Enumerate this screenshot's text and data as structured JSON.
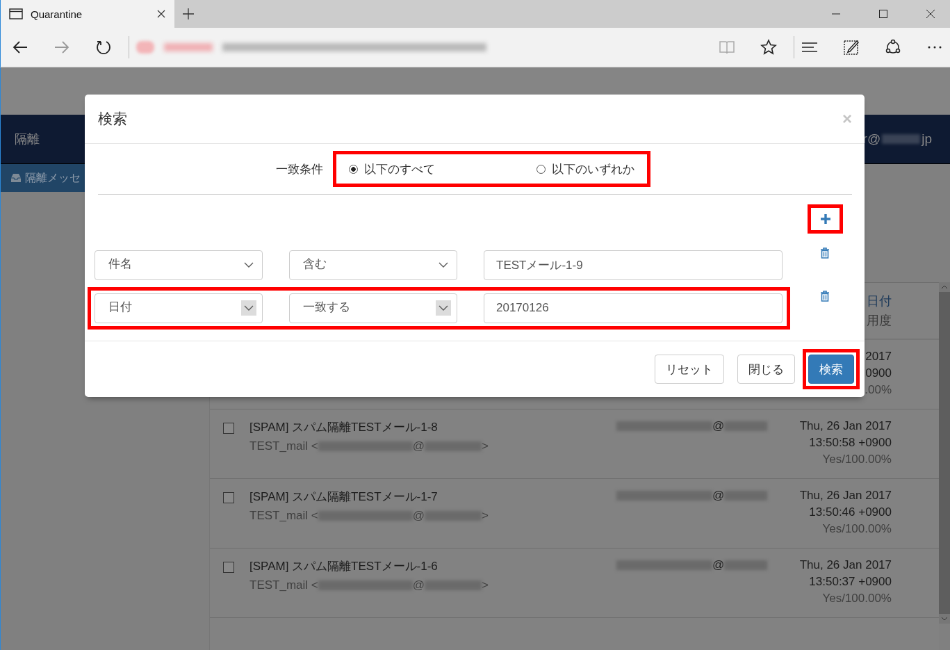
{
  "browser": {
    "tab_title": "Quarantine",
    "forward_disabled": true
  },
  "page": {
    "nav_title": "隔離",
    "user_prefix": "r@",
    "user_suffix": "jp",
    "sidebar_item": "隔離メッセ",
    "table_header": {
      "date": "日付",
      "score": "用度"
    },
    "partial_row": {
      "date": "2017",
      "time": "0900",
      "score": ".00%"
    },
    "rows": [
      {
        "checked": false,
        "subject": "[SPAM] スパム隔離TESTメール-1-8",
        "sender_prefix": "TEST_mail <",
        "sender_at": "@",
        "sender_end": ">",
        "recipient_at": "@",
        "date": "Thu, 26 Jan 2017",
        "time": "13:50:58 +0900",
        "score": "Yes/100.00%"
      },
      {
        "checked": false,
        "subject": "[SPAM] スパム隔離TESTメール-1-7",
        "sender_prefix": "TEST_mail <",
        "sender_at": "@",
        "sender_end": ">",
        "recipient_at": "@",
        "date": "Thu, 26 Jan 2017",
        "time": "13:50:46 +0900",
        "score": "Yes/100.00%"
      },
      {
        "checked": false,
        "subject": "[SPAM] スパム隔離TESTメール-1-6",
        "sender_prefix": "TEST_mail <",
        "sender_at": "@",
        "sender_end": ">",
        "recipient_at": "@",
        "date": "Thu, 26 Jan 2017",
        "time": "13:50:37 +0900",
        "score": "Yes/100.00%"
      }
    ]
  },
  "dialog": {
    "title": "検索",
    "close": "×",
    "match_label": "一致条件",
    "match_highlighted": true,
    "match_options": [
      {
        "label": "以下のすべて",
        "selected": true
      },
      {
        "label": "以下のいずれか",
        "selected": false
      }
    ],
    "add_highlighted": true,
    "conditions": [
      {
        "highlighted": false,
        "field": "件名",
        "operator": "含む",
        "value": "TESTメール-1-9",
        "arrow_boxed": false
      },
      {
        "highlighted": true,
        "field": "日付",
        "operator": "一致する",
        "value": "20170126",
        "arrow_boxed": true
      }
    ],
    "buttons": [
      {
        "label": "リセット",
        "kind": "default",
        "highlighted": false
      },
      {
        "label": "閉じる",
        "kind": "default",
        "highlighted": false
      },
      {
        "label": "検索",
        "kind": "primary",
        "highlighted": true
      }
    ]
  }
}
